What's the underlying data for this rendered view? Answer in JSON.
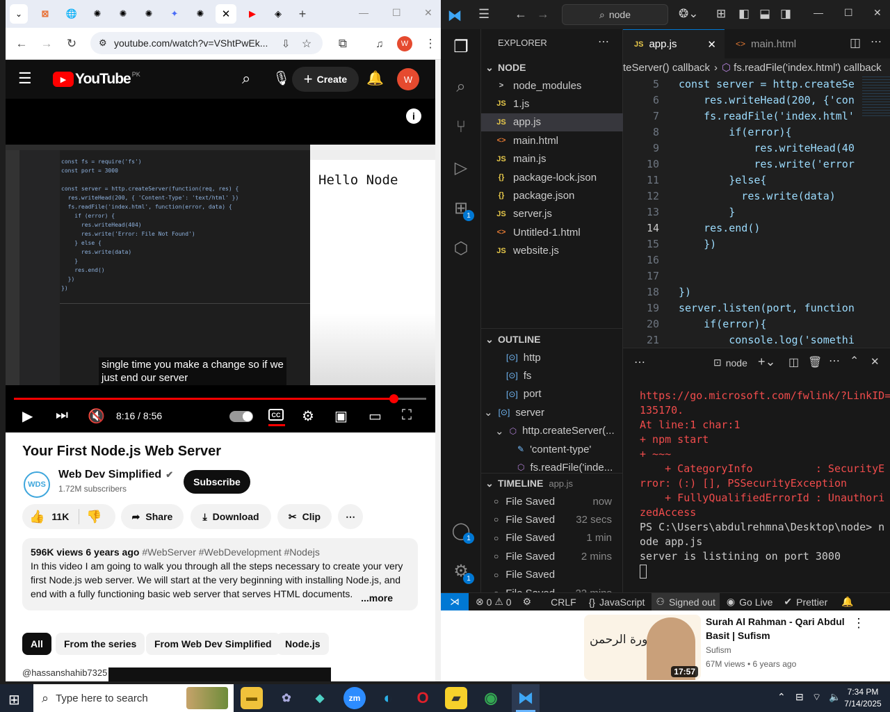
{
  "chrome": {
    "url": "youtube.com/watch?v=VShtPwEk...",
    "profile_initial": "W"
  },
  "youtube": {
    "logo": "YouTube",
    "region": "PK",
    "create_label": "Create",
    "avatar_initial": "W",
    "subtitle_line1": "single time you make a change so if we",
    "subtitle_line2": "just end our server",
    "time": "8:16 / 8:56",
    "progress": 0.92,
    "video_title": "Your First Node.js Web Server",
    "channel": "Web Dev Simplified",
    "subscribers": "1.72M subscribers",
    "subscribe_label": "Subscribe",
    "likes": "11K",
    "share_label": "Share",
    "download_label": "Download",
    "clip_label": "Clip",
    "desc_meta": "596K views  6 years ago",
    "desc_tags": "#WebServer #WebDevelopment #Nodejs",
    "desc_text": "In this video I am going to walk you through all the steps necessary to create your very first Node.js web server. We will start at the very beginning with installing Node.js, and end with a fully functioning basic web server that serves HTML documents.",
    "more_label": "...more",
    "chips": [
      "All",
      "From the series",
      "From Web Dev Simplified",
      "Node.js"
    ],
    "comment_peek": "@hassanshahib7325  8 months ago",
    "video_code": "const fs = require('fs')\nconst port = 3000\n\nconst server = http.createServer(function(req, res) {\n  res.writeHead(200, { 'Content-Type': 'text/html' })\n  fs.readFile('index.html', function(error, data) {\n    if (error) {\n      res.writeHead(404)\n      res.write('Error: File Not Found')\n    } else {\n      res.write(data)\n    }\n    res.end()\n  })\n})",
    "video_browser_text": "Hello Node"
  },
  "vscode": {
    "search": "node",
    "explorer_title": "EXPLORER",
    "folder": "NODE",
    "files": [
      {
        "icon": ">",
        "name": "node_modules",
        "type": "folder"
      },
      {
        "icon": "JS",
        "name": "1.js",
        "type": "js"
      },
      {
        "icon": "JS",
        "name": "app.js",
        "type": "js"
      },
      {
        "icon": "<>",
        "name": "main.html",
        "type": "html"
      },
      {
        "icon": "JS",
        "name": "main.js",
        "type": "js"
      },
      {
        "icon": "{}",
        "name": "package-lock.json",
        "type": "json"
      },
      {
        "icon": "{}",
        "name": "package.json",
        "type": "json"
      },
      {
        "icon": "JS",
        "name": "server.js",
        "type": "js"
      },
      {
        "icon": "<>",
        "name": "Untitled-1.html",
        "type": "html"
      },
      {
        "icon": "JS",
        "name": "website.js",
        "type": "js"
      }
    ],
    "outline_title": "OUTLINE",
    "outline": [
      "http",
      "fs",
      "port",
      "server",
      "http.createServer(...",
      "'content-type'",
      "fs.readFile('inde..."
    ],
    "timeline_title": "TIMELINE",
    "timeline_file": "app.js",
    "timeline": [
      {
        "label": "File Saved",
        "when": "now"
      },
      {
        "label": "File Saved",
        "when": "32 secs"
      },
      {
        "label": "File Saved",
        "when": "1 min"
      },
      {
        "label": "File Saved",
        "when": "2 mins"
      },
      {
        "label": "File Saved",
        "when": ""
      },
      {
        "label": "File Saved",
        "when": "22 mins"
      }
    ],
    "tab_active": "app.js",
    "tab_other": "main.html",
    "breadcrumb": "teServer() callback",
    "breadcrumb2": "fs.readFile('index.html') callback",
    "code": [
      {
        "n": "5",
        "t": "const server = http.createSe"
      },
      {
        "n": "6",
        "t": "    res.writeHead(200, {'con"
      },
      {
        "n": "7",
        "t": "    fs.readFile('index.html'"
      },
      {
        "n": "8",
        "t": "        if(error){"
      },
      {
        "n": "9",
        "t": "            res.writeHead(40"
      },
      {
        "n": "10",
        "t": "            res.write('error"
      },
      {
        "n": "11",
        "t": "        }else{"
      },
      {
        "n": "12",
        "t": "          res.write(data)"
      },
      {
        "n": "13",
        "t": "        }"
      },
      {
        "n": "14",
        "t": "    res.end()"
      },
      {
        "n": "15",
        "t": "    })"
      },
      {
        "n": "16",
        "t": ""
      },
      {
        "n": "17",
        "t": ""
      },
      {
        "n": "18",
        "t": "})"
      },
      {
        "n": "19",
        "t": "server.listen(port, function"
      },
      {
        "n": "20",
        "t": "    if(error){"
      },
      {
        "n": "21",
        "t": "        console.log('somethi"
      }
    ],
    "terminal_name": "node",
    "terminal_err": [
      "https://go.microsoft.com/fwlink/?LinkID=",
      "135170.",
      "At line:1 char:1",
      "+ npm start",
      "+ ~~~",
      "    + CategoryInfo          : SecurityE",
      "rror: (:) [], PSSecurityException",
      "    + FullyQualifiedErrorId : Unauthori",
      "zedAccess"
    ],
    "terminal_ok": [
      "PS C:\\Users\\abdulrehmna\\Desktop\\node> n",
      "ode app.js",
      "server is listining on port 3000"
    ],
    "status": {
      "errors": "0",
      "warnings": "0",
      "eol": "CRLF",
      "language": "JavaScript",
      "account": "Signed out",
      "golive": "Go Live",
      "prettier": "Prettier"
    },
    "badges": {
      "extensions": "1",
      "accounts": "1",
      "settings": "1"
    }
  },
  "sidecard": {
    "title": "Surah Al Rahman - Qari Abdul Basit | Sufism",
    "channel": "Sufism",
    "meta": "67M views • 6 years ago",
    "duration": "17:57",
    "thumb_title": "سورة الرحمن"
  },
  "taskbar": {
    "search_placeholder": "Type here to search",
    "time": "7:34 PM",
    "date": "7/14/2025"
  }
}
